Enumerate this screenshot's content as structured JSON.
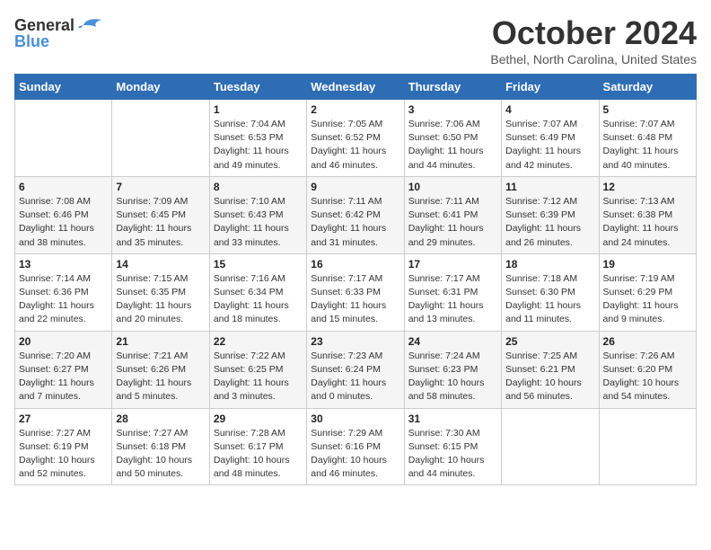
{
  "header": {
    "logo_general": "General",
    "logo_blue": "Blue",
    "month_title": "October 2024",
    "location": "Bethel, North Carolina, United States"
  },
  "days_of_week": [
    "Sunday",
    "Monday",
    "Tuesday",
    "Wednesday",
    "Thursday",
    "Friday",
    "Saturday"
  ],
  "weeks": [
    [
      {
        "day": "",
        "info": ""
      },
      {
        "day": "",
        "info": ""
      },
      {
        "day": "1",
        "info": "Sunrise: 7:04 AM\nSunset: 6:53 PM\nDaylight: 11 hours and 49 minutes."
      },
      {
        "day": "2",
        "info": "Sunrise: 7:05 AM\nSunset: 6:52 PM\nDaylight: 11 hours and 46 minutes."
      },
      {
        "day": "3",
        "info": "Sunrise: 7:06 AM\nSunset: 6:50 PM\nDaylight: 11 hours and 44 minutes."
      },
      {
        "day": "4",
        "info": "Sunrise: 7:07 AM\nSunset: 6:49 PM\nDaylight: 11 hours and 42 minutes."
      },
      {
        "day": "5",
        "info": "Sunrise: 7:07 AM\nSunset: 6:48 PM\nDaylight: 11 hours and 40 minutes."
      }
    ],
    [
      {
        "day": "6",
        "info": "Sunrise: 7:08 AM\nSunset: 6:46 PM\nDaylight: 11 hours and 38 minutes."
      },
      {
        "day": "7",
        "info": "Sunrise: 7:09 AM\nSunset: 6:45 PM\nDaylight: 11 hours and 35 minutes."
      },
      {
        "day": "8",
        "info": "Sunrise: 7:10 AM\nSunset: 6:43 PM\nDaylight: 11 hours and 33 minutes."
      },
      {
        "day": "9",
        "info": "Sunrise: 7:11 AM\nSunset: 6:42 PM\nDaylight: 11 hours and 31 minutes."
      },
      {
        "day": "10",
        "info": "Sunrise: 7:11 AM\nSunset: 6:41 PM\nDaylight: 11 hours and 29 minutes."
      },
      {
        "day": "11",
        "info": "Sunrise: 7:12 AM\nSunset: 6:39 PM\nDaylight: 11 hours and 26 minutes."
      },
      {
        "day": "12",
        "info": "Sunrise: 7:13 AM\nSunset: 6:38 PM\nDaylight: 11 hours and 24 minutes."
      }
    ],
    [
      {
        "day": "13",
        "info": "Sunrise: 7:14 AM\nSunset: 6:36 PM\nDaylight: 11 hours and 22 minutes."
      },
      {
        "day": "14",
        "info": "Sunrise: 7:15 AM\nSunset: 6:35 PM\nDaylight: 11 hours and 20 minutes."
      },
      {
        "day": "15",
        "info": "Sunrise: 7:16 AM\nSunset: 6:34 PM\nDaylight: 11 hours and 18 minutes."
      },
      {
        "day": "16",
        "info": "Sunrise: 7:17 AM\nSunset: 6:33 PM\nDaylight: 11 hours and 15 minutes."
      },
      {
        "day": "17",
        "info": "Sunrise: 7:17 AM\nSunset: 6:31 PM\nDaylight: 11 hours and 13 minutes."
      },
      {
        "day": "18",
        "info": "Sunrise: 7:18 AM\nSunset: 6:30 PM\nDaylight: 11 hours and 11 minutes."
      },
      {
        "day": "19",
        "info": "Sunrise: 7:19 AM\nSunset: 6:29 PM\nDaylight: 11 hours and 9 minutes."
      }
    ],
    [
      {
        "day": "20",
        "info": "Sunrise: 7:20 AM\nSunset: 6:27 PM\nDaylight: 11 hours and 7 minutes."
      },
      {
        "day": "21",
        "info": "Sunrise: 7:21 AM\nSunset: 6:26 PM\nDaylight: 11 hours and 5 minutes."
      },
      {
        "day": "22",
        "info": "Sunrise: 7:22 AM\nSunset: 6:25 PM\nDaylight: 11 hours and 3 minutes."
      },
      {
        "day": "23",
        "info": "Sunrise: 7:23 AM\nSunset: 6:24 PM\nDaylight: 11 hours and 0 minutes."
      },
      {
        "day": "24",
        "info": "Sunrise: 7:24 AM\nSunset: 6:23 PM\nDaylight: 10 hours and 58 minutes."
      },
      {
        "day": "25",
        "info": "Sunrise: 7:25 AM\nSunset: 6:21 PM\nDaylight: 10 hours and 56 minutes."
      },
      {
        "day": "26",
        "info": "Sunrise: 7:26 AM\nSunset: 6:20 PM\nDaylight: 10 hours and 54 minutes."
      }
    ],
    [
      {
        "day": "27",
        "info": "Sunrise: 7:27 AM\nSunset: 6:19 PM\nDaylight: 10 hours and 52 minutes."
      },
      {
        "day": "28",
        "info": "Sunrise: 7:27 AM\nSunset: 6:18 PM\nDaylight: 10 hours and 50 minutes."
      },
      {
        "day": "29",
        "info": "Sunrise: 7:28 AM\nSunset: 6:17 PM\nDaylight: 10 hours and 48 minutes."
      },
      {
        "day": "30",
        "info": "Sunrise: 7:29 AM\nSunset: 6:16 PM\nDaylight: 10 hours and 46 minutes."
      },
      {
        "day": "31",
        "info": "Sunrise: 7:30 AM\nSunset: 6:15 PM\nDaylight: 10 hours and 44 minutes."
      },
      {
        "day": "",
        "info": ""
      },
      {
        "day": "",
        "info": ""
      }
    ]
  ]
}
